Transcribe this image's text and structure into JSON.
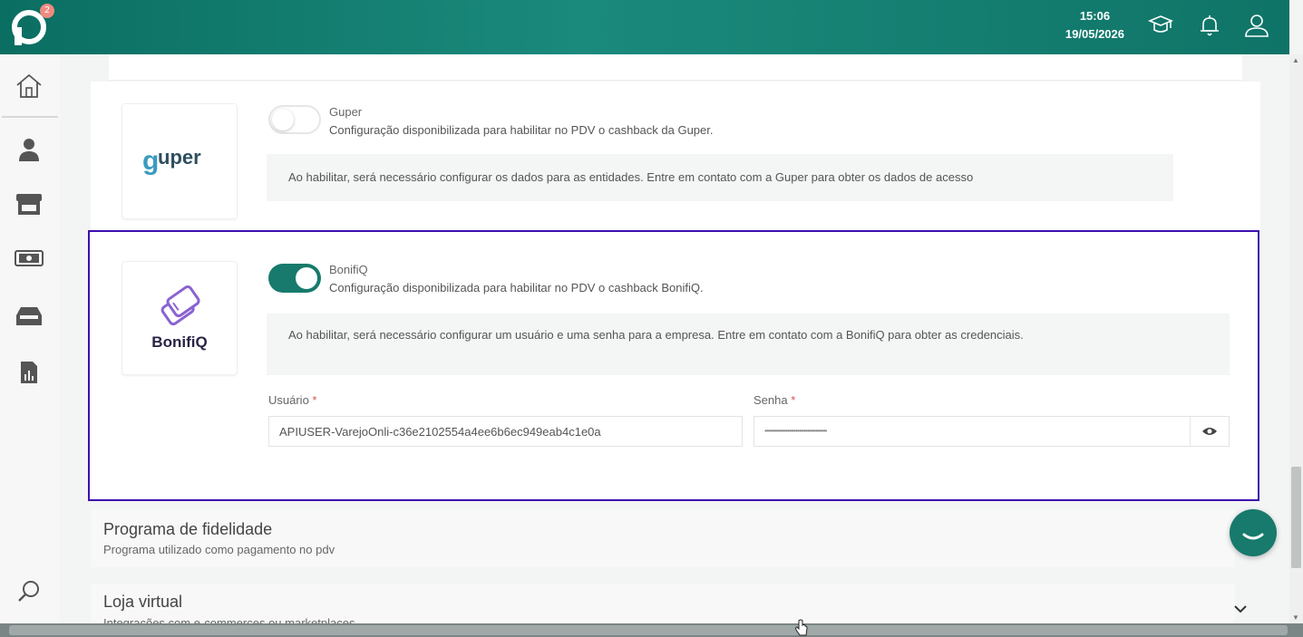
{
  "header": {
    "notification_count": "2",
    "time": "15:06",
    "date": "19/05/2026"
  },
  "sidebar": {
    "items": [
      "home-icon",
      "person-icon",
      "store-icon",
      "money-icon",
      "inbox-icon",
      "report-icon",
      "search-icon"
    ]
  },
  "integrations": [
    {
      "brand": "guper",
      "name": "Guper",
      "description": "Configuração disponibilizada para habilitar no PDV o cashback da Guper.",
      "enabled": false,
      "info": "Ao habilitar, será necessário configurar os dados para as entidades. Entre em contato com a Guper para obter os dados de acesso"
    },
    {
      "brand": "BonifiQ",
      "name": "BonifiQ",
      "description": "Configuração disponibilizada para habilitar no PDV o cashback BonifiQ.",
      "enabled": true,
      "info": "Ao habilitar, será necessário configurar um usuário e uma senha para a empresa. Entre em contato com a BonifiQ para obter as credenciais.",
      "user_label": "Usuário",
      "user_value": "APIUSER-VarejoOnli-c36e2102554a4ee6b6ec949eab4c1e0a",
      "password_label": "Senha",
      "password_value": "••••••••••••••••••••••••••••••••••••••",
      "required_mark": "*"
    }
  ],
  "sections": [
    {
      "title": "Programa de fidelidade",
      "subtitle": "Programa utilizado como pagamento no pdv"
    },
    {
      "title": "Loja virtual",
      "subtitle": "Integrações com e-commerces ou marketplaces"
    }
  ],
  "colors": {
    "brand": "#177a6c",
    "highlight_border": "#3d0fae",
    "required": "#d9534f"
  }
}
